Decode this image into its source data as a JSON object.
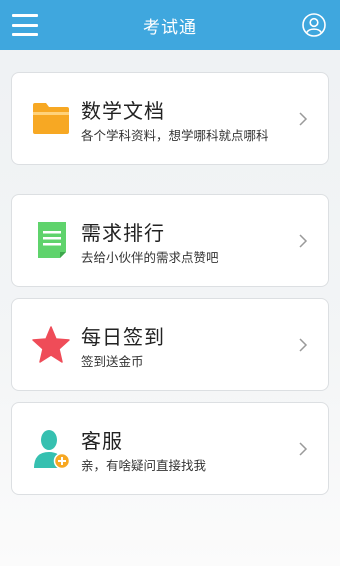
{
  "header": {
    "title": "考试通"
  },
  "items": [
    {
      "title": "数学文档",
      "desc": "各个学科资料，想学哪科就点哪科",
      "icon": "folder-icon"
    },
    {
      "title": "需求排行",
      "desc": "去给小伙伴的需求点赞吧",
      "icon": "document-icon"
    },
    {
      "title": "每日签到",
      "desc": "签到送金币",
      "icon": "star-icon"
    },
    {
      "title": "客服",
      "desc": "亲，有啥疑问直接找我",
      "icon": "support-agent-icon"
    }
  ],
  "colors": {
    "header": "#3fa7de",
    "folder": "#f7a823",
    "document": "#5fd36c",
    "star": "#ef4c58",
    "support": "#36c0b0"
  }
}
